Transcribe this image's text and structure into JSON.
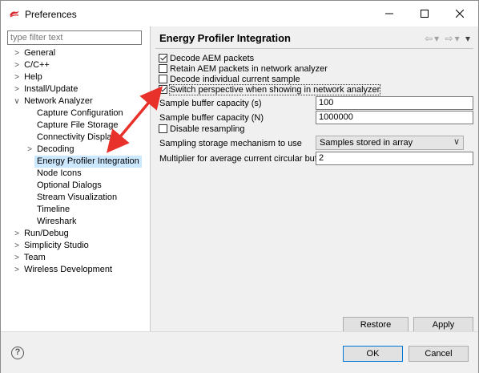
{
  "window": {
    "title": "Preferences",
    "minimize_label": "—",
    "maximize_label": "☐",
    "close_label": "✕"
  },
  "filter": {
    "placeholder": "type filter text"
  },
  "tree": {
    "items": [
      {
        "label": "General",
        "twisty": ">"
      },
      {
        "label": "C/C++",
        "twisty": ">"
      },
      {
        "label": "Help",
        "twisty": ">"
      },
      {
        "label": "Install/Update",
        "twisty": ">"
      },
      {
        "label": "Network Analyzer",
        "twisty": "∨"
      },
      {
        "label": "Capture Configuration",
        "twisty": ""
      },
      {
        "label": "Capture File Storage",
        "twisty": ""
      },
      {
        "label": "Connectivity Display",
        "twisty": ""
      },
      {
        "label": "Decoding",
        "twisty": ">"
      },
      {
        "label": "Energy Profiler Integration",
        "twisty": ""
      },
      {
        "label": "Node Icons",
        "twisty": ""
      },
      {
        "label": "Optional Dialogs",
        "twisty": ""
      },
      {
        "label": "Stream Visualization",
        "twisty": ""
      },
      {
        "label": "Timeline",
        "twisty": ""
      },
      {
        "label": "Wireshark",
        "twisty": ""
      },
      {
        "label": "Run/Debug",
        "twisty": ">"
      },
      {
        "label": "Simplicity Studio",
        "twisty": ">"
      },
      {
        "label": "Team",
        "twisty": ">"
      },
      {
        "label": "Wireless Development",
        "twisty": ">"
      }
    ]
  },
  "page": {
    "title": "Energy Profiler Integration",
    "nav": {
      "back": "⇦",
      "back_menu": "▾",
      "forward": "⇨",
      "forward_menu": "▾",
      "view_menu": "▾"
    },
    "checkboxes": {
      "decode_aem": {
        "label": "Decode AEM packets",
        "checked": true
      },
      "retain_aem": {
        "label": "Retain AEM packets in network analyzer",
        "checked": false
      },
      "decode_individual": {
        "label": "Decode individual current sample",
        "checked": false
      },
      "switch_perspective": {
        "label": "Switch perspective when showing in network analyzer",
        "checked": true
      },
      "disable_resampling": {
        "label": "Disable resampling",
        "checked": false
      }
    },
    "fields": {
      "sample_buffer_s": {
        "label": "Sample buffer capacity (s)",
        "value": "100"
      },
      "sample_buffer_n": {
        "label": "Sample buffer capacity (N)",
        "value": "1000000"
      },
      "storage_mechanism": {
        "label": "Sampling storage mechanism to use",
        "value": "Samples stored in array",
        "arrow": "∨"
      },
      "multiplier": {
        "label": "Multiplier for average current circular buffer",
        "value": "2"
      }
    },
    "buttons": {
      "restore_defaults": "Restore Defaults",
      "apply": "Apply"
    }
  },
  "footer": {
    "help": "?",
    "ok": "OK",
    "cancel": "Cancel"
  },
  "colors": {
    "selection": "#cce8ff",
    "annotation_arrow": "#e8312a",
    "default_button_border": "#0078d7"
  }
}
